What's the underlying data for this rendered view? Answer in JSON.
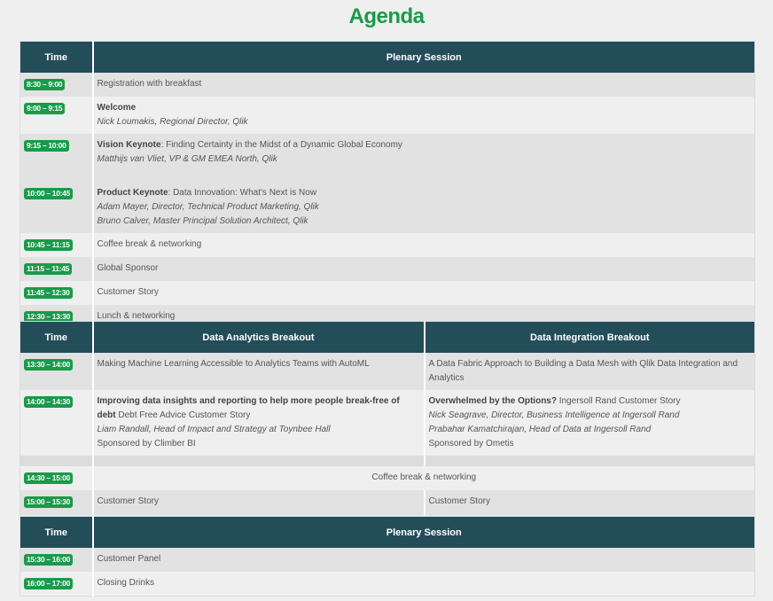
{
  "title": "Agenda",
  "colors": {
    "header_bg": "#244d5a",
    "badge": "#1a9a4a",
    "title": "#1a9a4a"
  },
  "section1": {
    "headers": [
      "Time",
      "Plenary Session"
    ],
    "rows": [
      {
        "time": "8:30 – 9:00",
        "lines": [
          {
            "text": "Registration with breakfast"
          }
        ]
      },
      {
        "time": "9:00 – 9:15",
        "bold": "Welcome",
        "rest": "",
        "sub": [
          "Nick Loumakis, Regional Director, Qlik"
        ]
      },
      {
        "time": "9:15 – 10:00",
        "bold": "Vision Keynote",
        "rest": ": Finding Certainty in the Midst of a Dynamic Global Economy",
        "sub": [
          "Matthijs van Vliet, VP & GM EMEA North, Qlik"
        ]
      },
      {
        "time": "10:00 – 10:45",
        "bold": "Product Keynote",
        "rest": ": Data Innovation: What's Next is Now",
        "sub": [
          "Adam Mayer, Director, Technical Product Marketing, Qlik",
          "Bruno Calver, Master Principal Solution Architect, Qlik"
        ]
      },
      {
        "time": "10:45 – 11:15",
        "text": "Coffee break & networking"
      },
      {
        "time": "11:15 – 11:45",
        "text": "Global Sponsor"
      },
      {
        "time": "11:45 – 12:30",
        "text": "Customer Story"
      },
      {
        "time": "12:30 – 13:30",
        "text": "Lunch & networking"
      }
    ]
  },
  "section2": {
    "headers": [
      "Time",
      "Data Analytics Breakout",
      "Data Integration Breakout"
    ],
    "r1": {
      "time": "13:30 – 14:00",
      "a": "Making Machine Learning Accessible to Analytics Teams with AutoML",
      "b": "A Data Fabric Approach to Building a Data Mesh with Qlik Data Integration and Analytics"
    },
    "r2": {
      "time": "14:00 – 14:30",
      "a_bold": "Improving data insights and reporting to help more people break-free of debt",
      "a_rest": " Debt Free Advice Customer Story",
      "a_speaker": "Liam Randall, Head of Impact and Strategy at Toynbee Hall",
      "a_sponsor": "Sponsored by Climber BI",
      "b_bold": "Overwhelmed by the Options?",
      "b_rest": " Ingersoll Rand Customer Story",
      "b_speaker1": "Nick Seagrave, Director, Business Intelligence at Ingersoll Rand",
      "b_speaker2": "Prabahar Kamatchirajan, Head of Data at Ingersoll Rand",
      "b_sponsor": "Sponsored by Ometis"
    },
    "r3": {
      "time": "14:30 – 15:00",
      "text": "Coffee break & networking"
    },
    "r4": {
      "time": "15:00 – 15:30",
      "a": "Customer Story",
      "b": "Customer Story"
    }
  },
  "section3": {
    "headers": [
      "Time",
      "Plenary Session"
    ],
    "r1": {
      "time": "15:30 – 16:00",
      "text": "Customer Panel"
    },
    "r2": {
      "time": "16:00 – 17:00",
      "text": "Closing Drinks"
    }
  }
}
